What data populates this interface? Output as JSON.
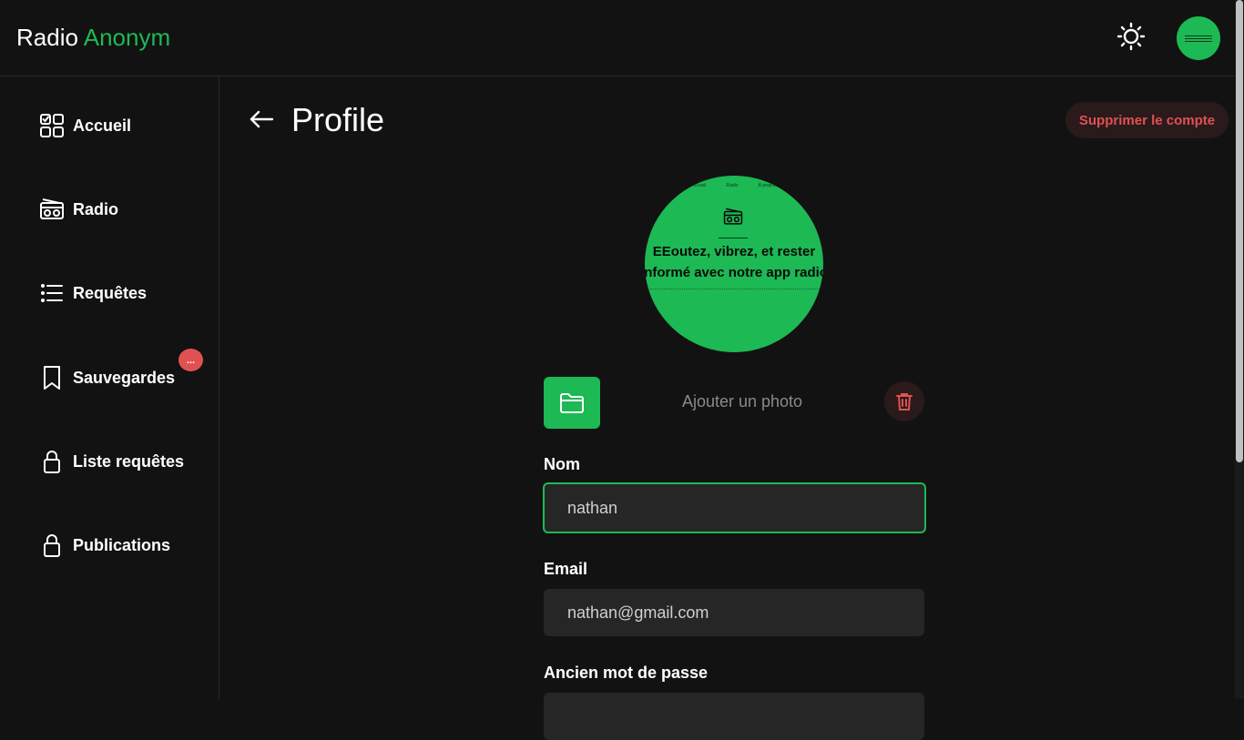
{
  "header": {
    "brand_first": "Radio",
    "brand_second": "Anonym",
    "theme_icon": "sun-icon"
  },
  "sidebar": {
    "items": [
      {
        "label": "Accueil",
        "icon": "dashboard-icon"
      },
      {
        "label": "Radio",
        "icon": "radio-icon"
      },
      {
        "label": "Requêtes",
        "icon": "list-icon"
      },
      {
        "label": "Sauvegardes",
        "icon": "bookmark-icon"
      },
      {
        "label": "Liste requêtes",
        "icon": "lock-icon"
      },
      {
        "label": "Publications",
        "icon": "lock-icon"
      }
    ],
    "badge_text": "..."
  },
  "main": {
    "title": "Profile",
    "delete_account_label": "Supprimer le compte",
    "photo": {
      "hero_line1": "EEoutez, vibrez, et rester",
      "hero_line2": "informé avec notre app radio",
      "top_links": [
        "Accueil",
        "Radio",
        "À propos"
      ]
    },
    "add_photo_label": "Ajouter un photo",
    "fields": {
      "name_label": "Nom",
      "name_value": "nathan",
      "email_label": "Email",
      "email_value": "nathan@gmail.com",
      "old_password_label": "Ancien mot de passe"
    }
  },
  "colors": {
    "accent": "#1db954",
    "background": "#121212",
    "danger": "#e05252"
  }
}
